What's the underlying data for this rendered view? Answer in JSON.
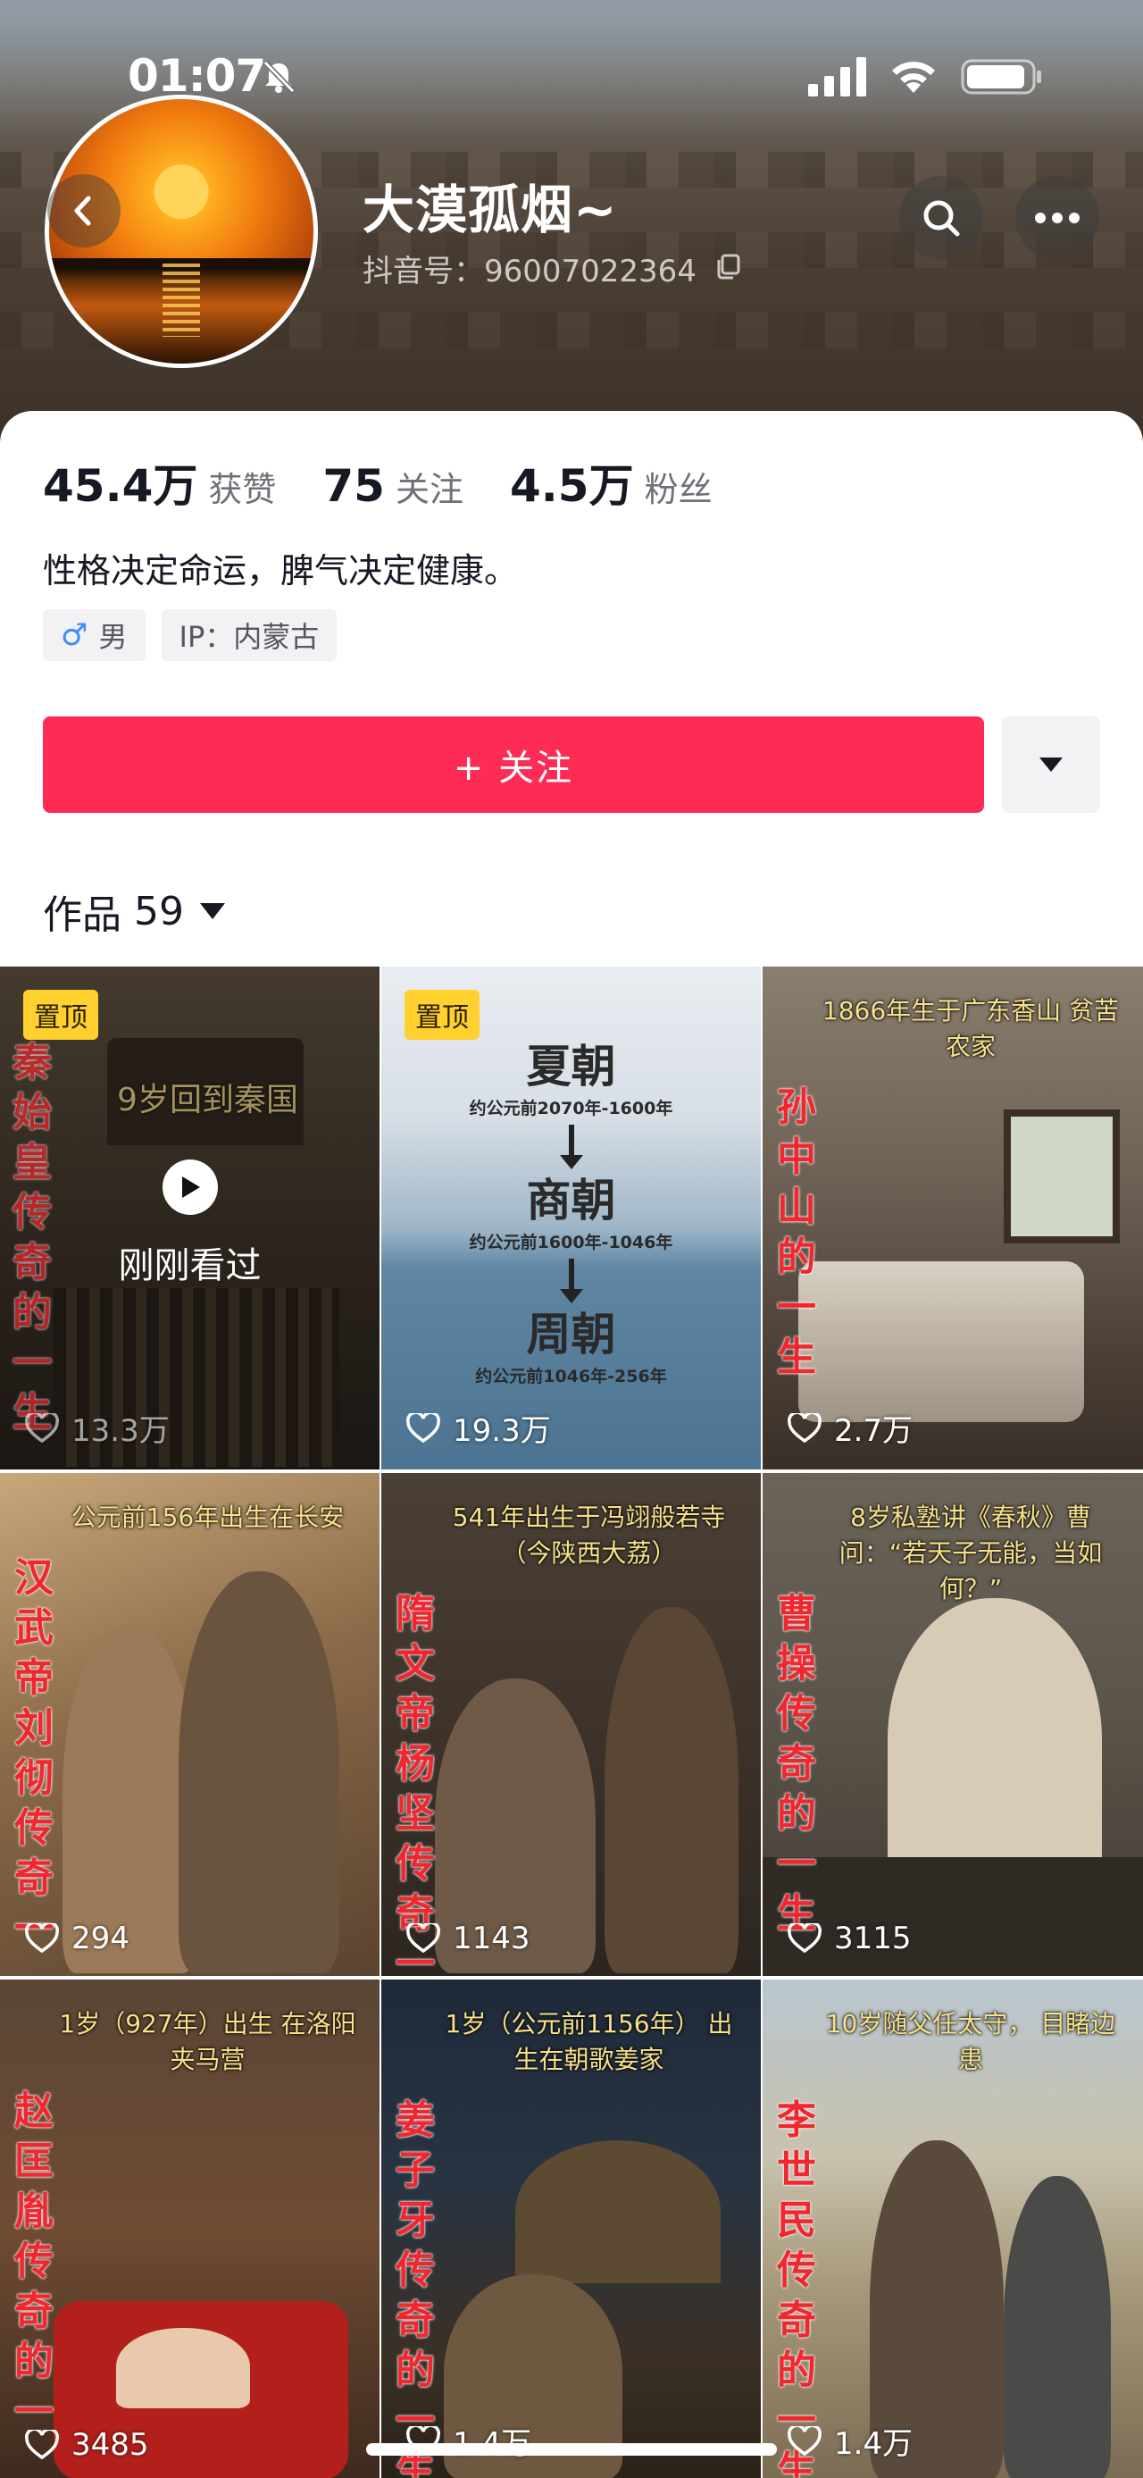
{
  "status_bar": {
    "time": "01:07"
  },
  "profile": {
    "nickname": "大漠孤烟~",
    "douyin_id": "抖音号：96007022364"
  },
  "stats": [
    {
      "value": "45.4万",
      "label": "获赞"
    },
    {
      "value": "75",
      "label": "关注"
    },
    {
      "value": "4.5万",
      "label": "粉丝"
    }
  ],
  "bio": "性格决定命运，脾气决定健康。",
  "tags": {
    "gender": "男",
    "ip": "IP：内蒙古"
  },
  "actions": {
    "follow": "+ 关注"
  },
  "works_tab": {
    "label": "作品",
    "count": "59"
  },
  "videos": [
    {
      "title": "秦始皇传奇的一生",
      "caption": "9岁回到秦国",
      "likes": "13.3万",
      "pinned": "置顶",
      "recent": "刚刚看过"
    },
    {
      "title": "",
      "caption": "",
      "likes": "19.3万",
      "pinned": "置顶",
      "dynasties": [
        {
          "name": "夏朝",
          "date": "约公元前2070年-1600年"
        },
        {
          "name": "商朝",
          "date": "约公元前1600年-1046年"
        },
        {
          "name": "周朝",
          "date": "约公元前1046年-256年"
        }
      ]
    },
    {
      "title": "孙中山的一生",
      "caption": "1866年生于广东香山 贫苦农家",
      "likes": "2.7万"
    },
    {
      "title": "汉武帝刘彻传奇一",
      "caption": "公元前156年出生在长安",
      "likes": "294"
    },
    {
      "title": "隋文帝杨坚传奇一",
      "caption": "541年出生于冯翊般若寺 （今陕西大荔）",
      "likes": "1143"
    },
    {
      "title": "曹操传奇的一生",
      "caption": "8岁私塾讲《春秋》曹问：“若天子无能，当如何？”",
      "likes": "3115"
    },
    {
      "title": "赵匡胤传奇的一",
      "caption": "1岁（927年）出生 在洛阳夹马营",
      "likes": "3485"
    },
    {
      "title": "姜子牙传奇的一生",
      "caption": "1岁（公元前1156年） 出生在朝歌姜家",
      "likes": "1.4万"
    },
    {
      "title": "李世民传奇的一生",
      "caption": "10岁随父任太守， 目睹边患",
      "likes": "1.4万"
    }
  ],
  "colors": {
    "brand_red": "#fe2c55",
    "pin_yellow": "#ffd02e",
    "title_red": "#f0272e"
  }
}
